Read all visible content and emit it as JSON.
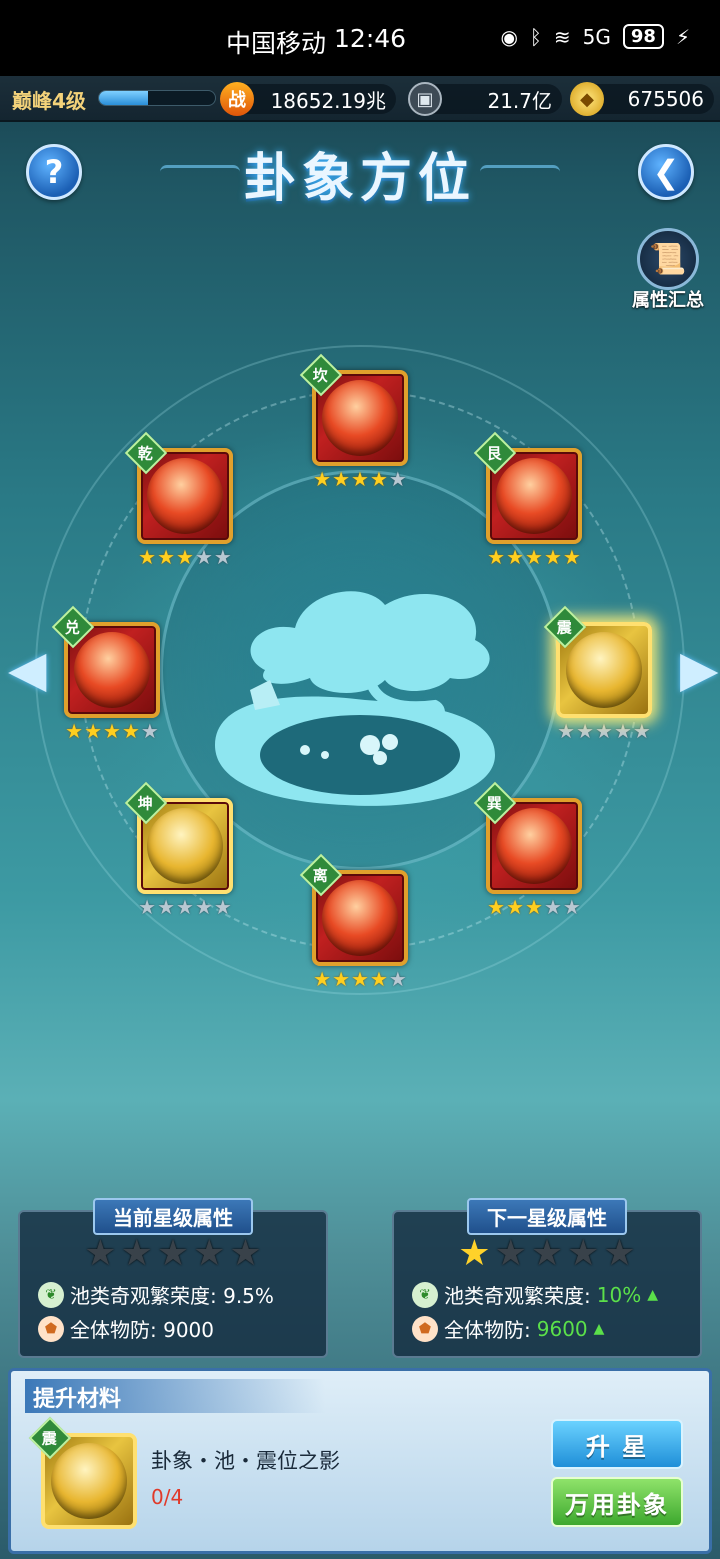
{
  "status_bar": {
    "carrier": "中国移动",
    "time": "12:46",
    "signal": "5G",
    "battery": "98"
  },
  "resources": {
    "level": "巅峰4级",
    "xp_fraction": 0.42,
    "power_icon": "战",
    "power": "18652.19兆",
    "silver": "21.7亿",
    "gold": "675506"
  },
  "header": {
    "title": "卦象方位",
    "help_label": "?",
    "summary_label": "属性汇总"
  },
  "trigrams": [
    {
      "name": "坎",
      "stars": 4,
      "color": "red",
      "selected": false
    },
    {
      "name": "乾",
      "stars": 3,
      "color": "red",
      "selected": false
    },
    {
      "name": "艮",
      "stars": 5,
      "color": "red",
      "selected": false
    },
    {
      "name": "兑",
      "stars": 4,
      "color": "red",
      "selected": false
    },
    {
      "name": "震",
      "stars": 0,
      "color": "gold",
      "selected": true
    },
    {
      "name": "坤",
      "stars": 0,
      "color": "gold",
      "selected": false
    },
    {
      "name": "巽",
      "stars": 3,
      "color": "red",
      "selected": false
    },
    {
      "name": "离",
      "stars": 4,
      "color": "red",
      "selected": false
    }
  ],
  "current_panel": {
    "title": "当前星级属性",
    "stars": 0,
    "attr1_label": "池类奇观繁荣度: 9.5%",
    "attr2_label": "全体物防: 9000"
  },
  "next_panel": {
    "title": "下一星级属性",
    "stars": 1,
    "attr1_label": "池类奇观繁荣度: ",
    "attr1_value": "10%",
    "attr2_label": "全体物防: ",
    "attr2_value": "9600"
  },
  "materials": {
    "title": "提升材料",
    "item_tag": "震",
    "item_name": "卦象・池・震位之影",
    "item_count": "0/4",
    "upgrade_button": "升 星",
    "universal_button": "万用卦象"
  },
  "colors": {
    "star_on": "#ffcf1f",
    "star_off": "#b8c8d2",
    "accent_green": "#5be04a",
    "count_red": "#e03a2a"
  }
}
